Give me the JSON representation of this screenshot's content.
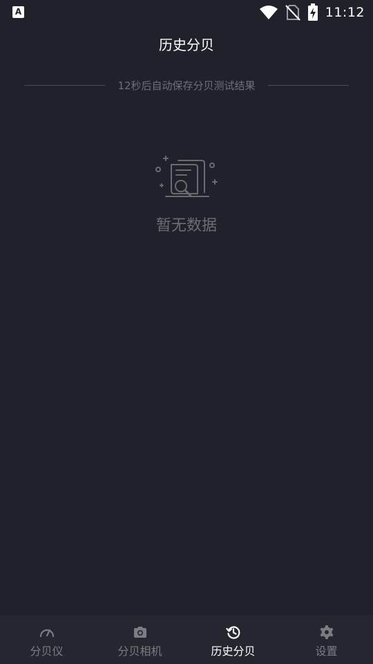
{
  "status_bar": {
    "app_icon_letter": "A",
    "time": "11:12",
    "icons": [
      "wifi-icon",
      "no-sim-icon",
      "battery-charging-icon"
    ]
  },
  "header": {
    "title": "历史分贝"
  },
  "save_hint": {
    "text": "12秒后自动保存分贝测试结果"
  },
  "empty_state": {
    "icon": "document-search-icon",
    "text": "暂无数据"
  },
  "bottom_nav": {
    "items": [
      {
        "label": "分贝仪",
        "icon": "speedometer-icon",
        "active": false
      },
      {
        "label": "分贝相机",
        "icon": "camera-icon",
        "active": false
      },
      {
        "label": "历史分贝",
        "icon": "history-icon",
        "active": true
      },
      {
        "label": "设置",
        "icon": "gear-icon",
        "active": false
      }
    ]
  },
  "colors": {
    "background": "#20212a",
    "nav_background": "#262630",
    "active": "#ffffff",
    "inactive": "#7b7c84",
    "muted_text": "#6e6f78"
  }
}
